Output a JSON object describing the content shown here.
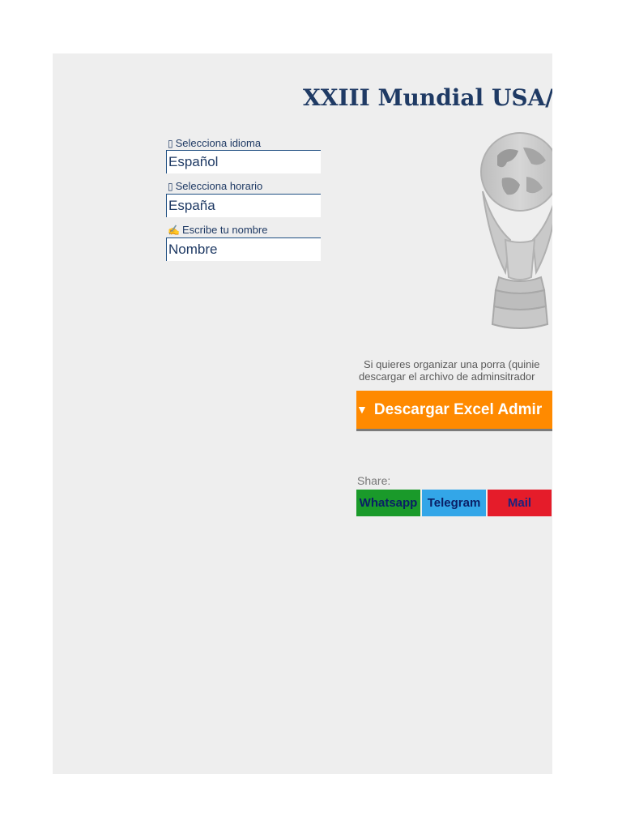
{
  "page": {
    "title": "XXIII Mundial USA/M"
  },
  "fields": [
    {
      "label_icon": "▯",
      "label": "Selecciona idioma",
      "value": "Español"
    },
    {
      "label_icon": "▯",
      "label": "Selecciona horario",
      "value": "España"
    },
    {
      "label_icon": "✍",
      "label": "Escribe tu nombre",
      "value": "Nombre"
    }
  ],
  "info": {
    "line1": "Si quieres organizar una porra (quinie",
    "line2": "descargar el archivo de adminsitrador"
  },
  "download": {
    "arrow": "▼",
    "label": "Descargar Excel Admir"
  },
  "share": {
    "label": "Share:",
    "whatsapp": "Whatsapp",
    "telegram": "Telegram",
    "mail": "Mail"
  },
  "colors": {
    "title": "#1f3a64",
    "download_bg": "#ff8a00",
    "whatsapp": "#1a9a2a",
    "telegram": "#33a6e8",
    "mail": "#e51c2a",
    "sheet_bg": "#eeeeee"
  },
  "icons": {
    "trophy": "world-cup-trophy-icon"
  }
}
